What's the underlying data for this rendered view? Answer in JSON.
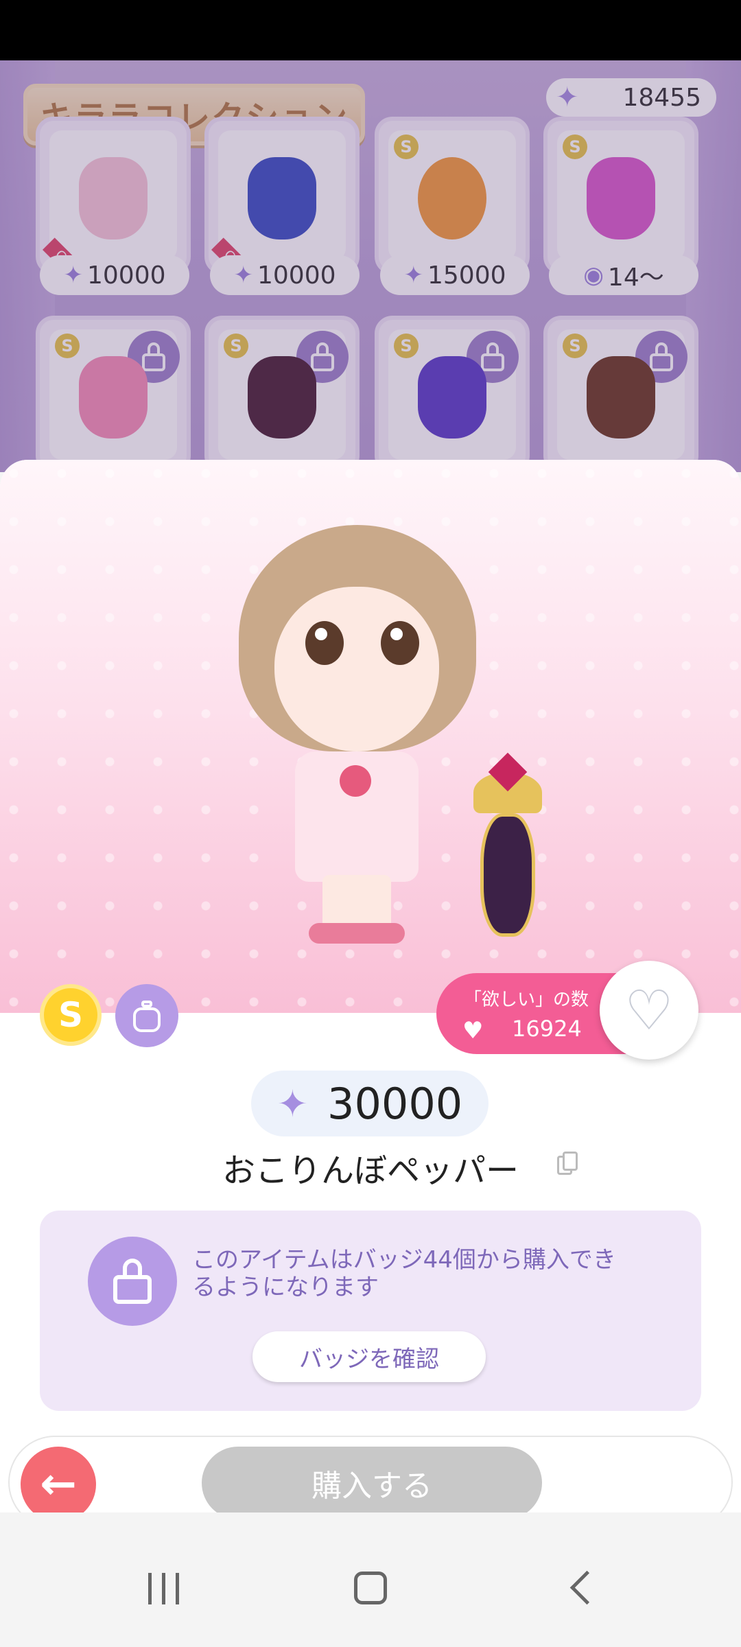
{
  "shop": {
    "title": "キララコレクション",
    "sparkle_balance": "18455",
    "top_row": [
      {
        "price": "10000",
        "owned_label": "GET",
        "price_icon": "sparkle-icon"
      },
      {
        "price": "10000",
        "owned_label": "GET",
        "price_icon": "sparkle-icon"
      },
      {
        "price": "15000",
        "owned_label": "",
        "price_icon": "sparkle-icon"
      },
      {
        "price": "14〜",
        "owned_label": "",
        "price_icon": "badge-icon"
      }
    ]
  },
  "detail": {
    "want_label": "「欲しい」の数",
    "want_count": "16924",
    "price": "30000",
    "item_name": "おこりんぼペッパー",
    "lock_message": "このアイテムはバッジ44個から購入できるようになります",
    "confirm_badge_label": "バッジを確認",
    "buy_label": "購入する",
    "badges": [
      "coin-badge-icon",
      "perfume-badge-icon"
    ]
  },
  "colors": {
    "accent_purple": "#7e68b9",
    "want_pink": "#f35d95",
    "back_red": "#f46a73",
    "buy_disabled": "#c8c8c8"
  }
}
